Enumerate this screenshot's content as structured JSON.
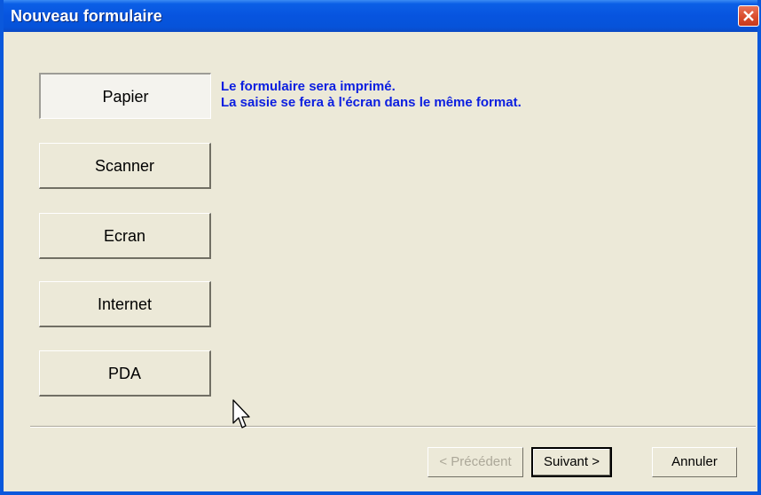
{
  "window": {
    "title": "Nouveau formulaire",
    "close_icon": "close-icon"
  },
  "options": [
    {
      "label": "Papier",
      "selected": true
    },
    {
      "label": "Scanner",
      "selected": false
    },
    {
      "label": "Ecran",
      "selected": false
    },
    {
      "label": "Internet",
      "selected": false
    },
    {
      "label": "PDA",
      "selected": false
    }
  ],
  "description": {
    "line1": "Le formulaire sera imprimé.",
    "line2": "La saisie se fera à l'écran dans le même format."
  },
  "footer": {
    "previous_label": "< Précédent",
    "next_label": "Suivant >",
    "cancel_label": "Annuler"
  },
  "colors": {
    "titlebar": "#0754df",
    "description_text": "#0b1ee0",
    "dialog_bg": "#ece9d8",
    "close_button": "#d84a2a"
  }
}
